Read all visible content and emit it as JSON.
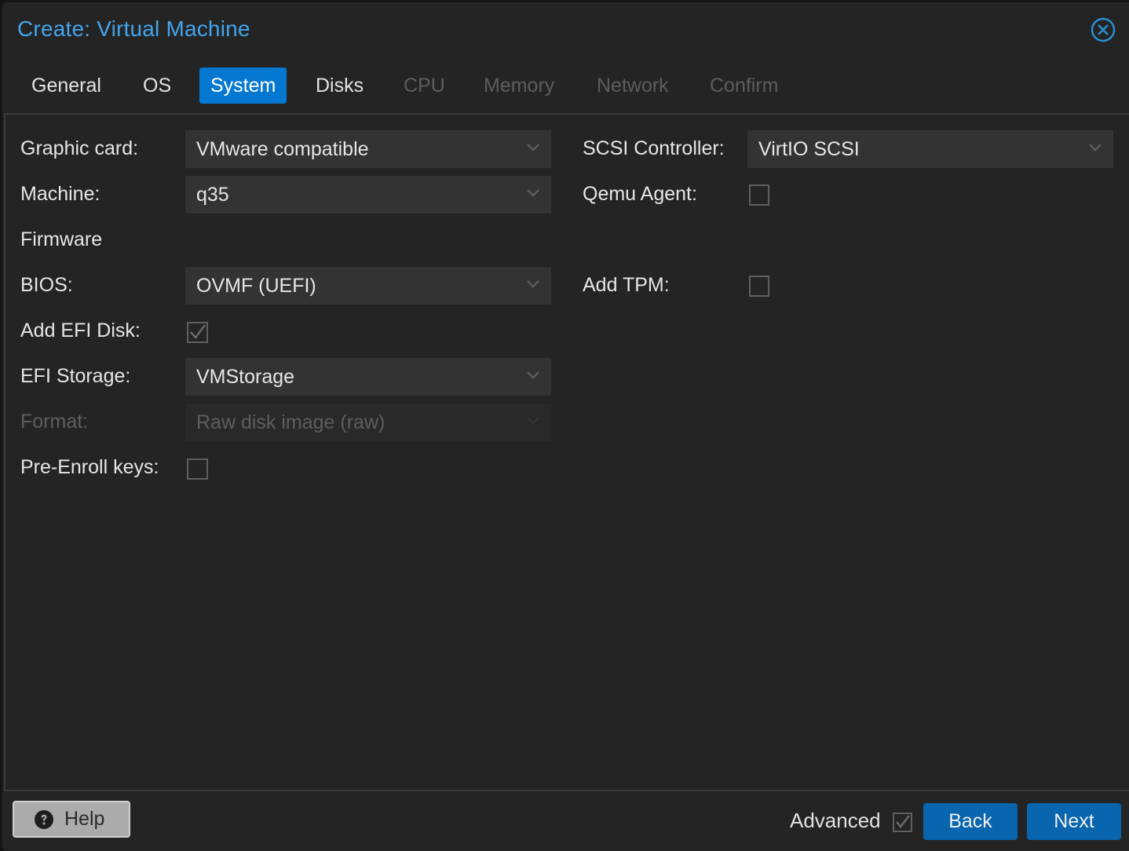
{
  "dialog": {
    "title": "Create: Virtual Machine",
    "close_icon": "circle-x-icon"
  },
  "tabs": [
    {
      "label": "General",
      "state": "enabled"
    },
    {
      "label": "OS",
      "state": "enabled"
    },
    {
      "label": "System",
      "state": "active"
    },
    {
      "label": "Disks",
      "state": "enabled"
    },
    {
      "label": "CPU",
      "state": "disabled"
    },
    {
      "label": "Memory",
      "state": "disabled"
    },
    {
      "label": "Network",
      "state": "disabled"
    },
    {
      "label": "Confirm",
      "state": "disabled"
    }
  ],
  "form": {
    "graphic_card": {
      "label": "Graphic card:",
      "value": "VMware compatible"
    },
    "machine": {
      "label": "Machine:",
      "value": "q35"
    },
    "firmware_heading": "Firmware",
    "bios": {
      "label": "BIOS:",
      "value": "OVMF (UEFI)"
    },
    "add_efi_disk": {
      "label": "Add EFI Disk:",
      "checked": true
    },
    "efi_storage": {
      "label": "EFI Storage:",
      "value": "VMStorage"
    },
    "format": {
      "label": "Format:",
      "value": "Raw disk image (raw)",
      "disabled": true
    },
    "pre_enroll_keys": {
      "label": "Pre-Enroll keys:",
      "checked": false
    },
    "scsi_controller": {
      "label": "SCSI Controller:",
      "value": "VirtIO SCSI"
    },
    "qemu_agent": {
      "label": "Qemu Agent:",
      "checked": false
    },
    "add_tpm": {
      "label": "Add TPM:",
      "checked": false
    }
  },
  "footer": {
    "help_label": "Help",
    "help_icon": "question-circle-icon",
    "advanced_label": "Advanced",
    "advanced_checked": true,
    "back_label": "Back",
    "next_label": "Next"
  },
  "colors": {
    "accent": "#0478d0",
    "title": "#42a5ec",
    "button_primary": "#0865ae",
    "background": "#242424",
    "field": "#333333"
  }
}
